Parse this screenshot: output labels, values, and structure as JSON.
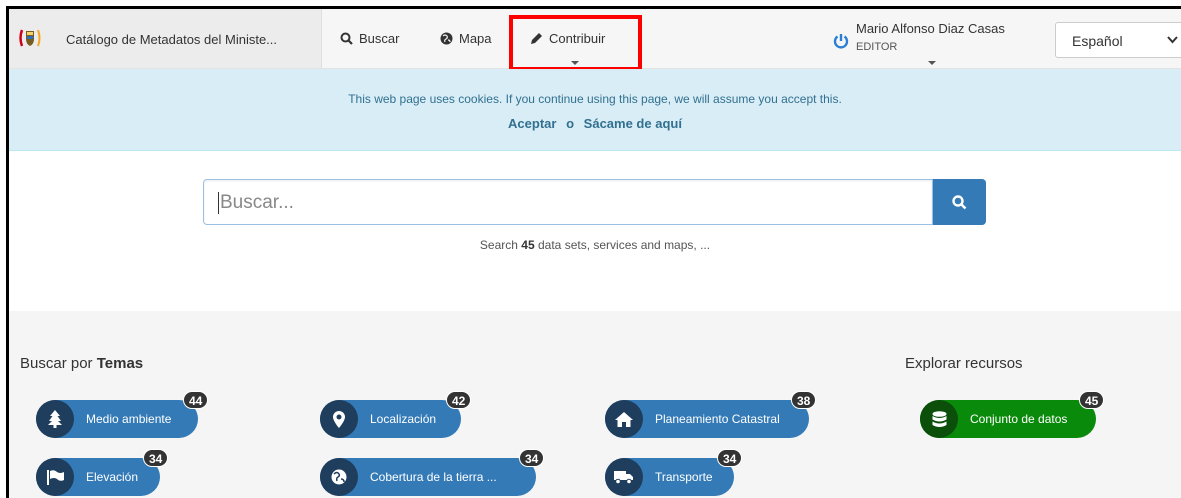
{
  "navbar": {
    "brand_title": "Catálogo de Metadatos del Ministe...",
    "items": [
      {
        "label": "Buscar",
        "icon": "search-icon"
      },
      {
        "label": "Mapa",
        "icon": "globe-icon"
      },
      {
        "label": "Contribuir",
        "icon": "pencil-icon"
      }
    ],
    "user": {
      "name": "Mario Alfonso Diaz Casas",
      "role": "EDITOR"
    },
    "language": "Español"
  },
  "cookie": {
    "message": "This web page uses cookies. If you continue using this page, we will assume you accept this.",
    "accept_label": "Aceptar",
    "or_label": "o",
    "leave_label": "Sácame de aquí"
  },
  "search": {
    "placeholder": "Buscar...",
    "hint_prefix": "Search",
    "hint_count": "45",
    "hint_suffix": "data sets, services and maps, ..."
  },
  "topics": {
    "title_prefix": "Buscar por",
    "title_bold": "Temas",
    "items": [
      {
        "label": "Medio ambiente",
        "count": "44",
        "icon": "tree-icon"
      },
      {
        "label": "Localización",
        "count": "42",
        "icon": "map-marker-icon"
      },
      {
        "label": "Planeamiento Catastral",
        "count": "38",
        "icon": "home-icon"
      },
      {
        "label": "Elevación",
        "count": "34",
        "icon": "flag-icon"
      },
      {
        "label": "Cobertura de la tierra ...",
        "count": "34",
        "icon": "globe-icon"
      },
      {
        "label": "Transporte",
        "count": "34",
        "icon": "truck-icon"
      }
    ]
  },
  "resources": {
    "title": "Explorar recursos",
    "items": [
      {
        "label": "Conjunto de datos",
        "count": "45",
        "icon": "database-icon"
      }
    ]
  },
  "colors": {
    "primary": "#337ab7",
    "cookie_bg": "#d9edf7",
    "resource_green": "#0a8a0a",
    "highlight": "#ff0000"
  }
}
